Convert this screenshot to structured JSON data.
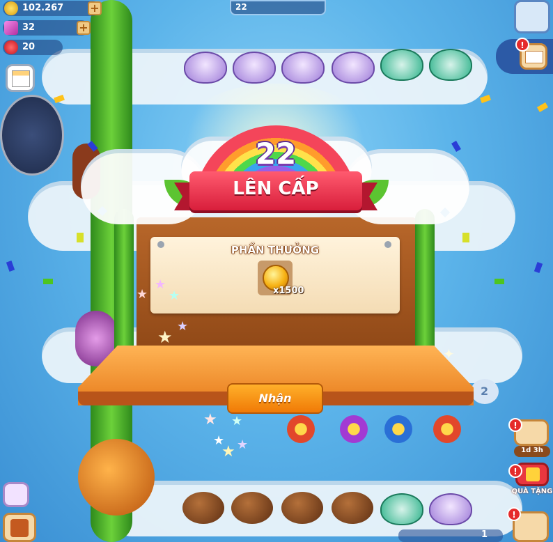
{
  "resources": {
    "coins": "102.267",
    "gems": "32",
    "lives": "20"
  },
  "top_level_display": "22",
  "dialog": {
    "level": "22",
    "title": "LÊN CẤP",
    "reward_header": "PHẦN THƯỞNG",
    "reward_amount": "x1500",
    "claim_label": "Nhận"
  },
  "side": {
    "timer": "1d 3h",
    "gift_label": "QUÀ TẶNG"
  },
  "map": {
    "bubble_number": "2",
    "bottom_bar_count": "1"
  },
  "colors": {
    "sky": "#5cb4ea",
    "ribbon": "#e8324a",
    "button": "#f58a10"
  },
  "icons": [
    "coin-icon",
    "gem-icon",
    "heart-icon",
    "plus-icon",
    "mail-icon",
    "task-board-icon",
    "backpack-icon",
    "gift-icon",
    "star-icon"
  ]
}
